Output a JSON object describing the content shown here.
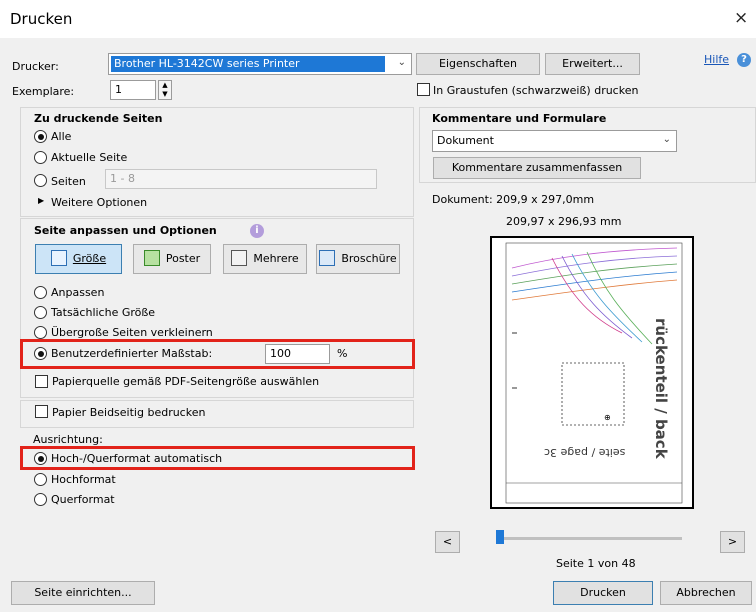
{
  "window": {
    "title": "Drucken",
    "close_glyph": "×"
  },
  "printer": {
    "label": "Drucker:",
    "value": "Brother HL-3142CW series Printer",
    "properties_button": "Eigenschaften",
    "advanced_button": "Erweitert...",
    "help_link": "Hilfe"
  },
  "copies": {
    "label": "Exemplare:",
    "value": "1",
    "grayscale_label": "In Graustufen (schwarzweiß) drucken"
  },
  "pages": {
    "title": "Zu druckende Seiten",
    "all": "Alle",
    "current": "Aktuelle Seite",
    "pages": "Seiten",
    "range_placeholder": "1 - 8",
    "more_options": "Weitere Optionen",
    "more_glyph": "▶"
  },
  "sizing": {
    "title": "Seite anpassen und Optionen",
    "info_glyph": "i",
    "buttons": [
      "Größe",
      "Poster",
      "Mehrere",
      "Broschüre"
    ],
    "fit": "Anpassen",
    "actual": "Tatsächliche Größe",
    "shrink": "Übergroße Seiten verkleinern",
    "custom_scale": "Benutzerdefinierter Maßstab:",
    "scale_value": "100",
    "percent": "%",
    "paper_source": "Papierquelle gemäß PDF-Seitengröße auswählen"
  },
  "duplex": {
    "label": "Papier Beidseitig bedrucken"
  },
  "orientation": {
    "title": "Ausrichtung:",
    "auto": "Hoch-/Querformat automatisch",
    "portrait": "Hochformat",
    "landscape": "Querformat"
  },
  "comments": {
    "title": "Kommentare und Formulare",
    "value": "Dokument",
    "summarize_button": "Kommentare zusammenfassen"
  },
  "preview": {
    "document_size": "Dokument: 209,9 x 297,0mm",
    "page_size": "209,97 x 296,93 mm",
    "page_text_main": "rückenteil / back",
    "page_text_sub": "seite / page 3c",
    "prev": "<",
    "next": ">",
    "page_status": "Seite 1 von 48"
  },
  "footer": {
    "setup_button": "Seite einrichten...",
    "print_button": "Drucken",
    "cancel_button": "Abbrechen"
  },
  "colors": {
    "accent": "#1e78d6",
    "highlight": "#e2231a"
  }
}
